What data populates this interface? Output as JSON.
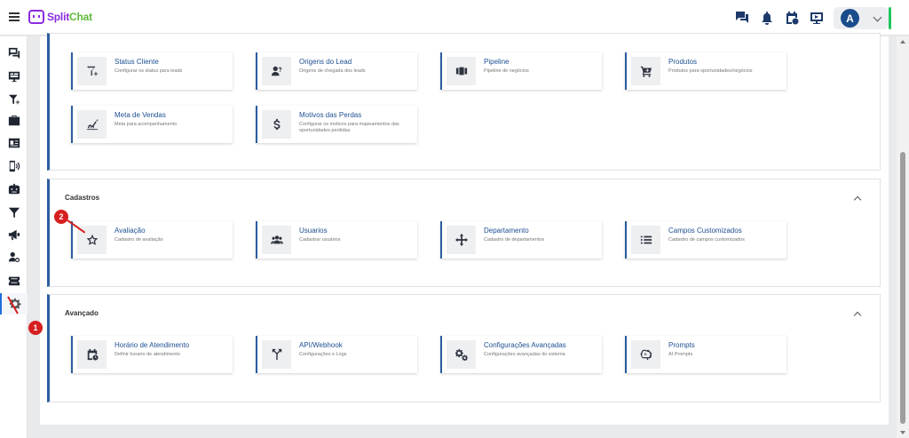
{
  "app": {
    "logo_split": "Split",
    "logo_chat": "Chat"
  },
  "user": {
    "initial": "A"
  },
  "colors": {
    "accent": "#2b5d9f",
    "marker": "#d61f1f",
    "brand_purple": "#8a2be2",
    "brand_green": "#5fb83a"
  },
  "top_icons": [
    "chat-icon",
    "bell-icon",
    "calendar-clock-icon",
    "video-icon"
  ],
  "rail_icons": [
    "conversations-icon",
    "monitor-icon",
    "filter-plus-icon",
    "briefcase-icon",
    "contact-card-icon",
    "phone-signal-icon",
    "robot-icon",
    "filter-icon",
    "megaphone-icon",
    "user-search-icon",
    "ticket-icon",
    "gear-icon"
  ],
  "sections": {
    "top": {
      "cards": [
        {
          "title": "Status Cliente",
          "desc": "Configurar os status para leads",
          "icon": "filter-plus-icon"
        },
        {
          "title": "Origens do Lead",
          "desc": "Origens de chegada dos leads",
          "icon": "user-question-icon"
        },
        {
          "title": "Pipeline",
          "desc": "Pipeline de negócios",
          "icon": "pipeline-icon"
        },
        {
          "title": "Produtos",
          "desc": "Produtos para oportunidades/negócios",
          "icon": "cart-plus-icon"
        },
        {
          "title": "Meta de Vendas",
          "desc": "Meta para acompanhamento",
          "icon": "chart-trend-icon"
        },
        {
          "title": "Motivos das Perdas",
          "desc": "Configurar os motivos para mapeamentos das oportunidades perdidas",
          "icon": "dollar-icon"
        }
      ]
    },
    "cadastros": {
      "title": "Cadastros",
      "cards": [
        {
          "title": "Avaliação",
          "desc": "Cadastro de avaliação",
          "icon": "star-icon"
        },
        {
          "title": "Usuarios",
          "desc": "Cadastrar usuários",
          "icon": "users-icon"
        },
        {
          "title": "Departamento",
          "desc": "Cadastro de departamentos",
          "icon": "move-arrows-icon"
        },
        {
          "title": "Campos Customizados",
          "desc": "Cadastro de campos customizados",
          "icon": "list-icon"
        }
      ]
    },
    "avancado": {
      "title": "Avançado",
      "cards": [
        {
          "title": "Horário de Atendimento",
          "desc": "Definir horario de atendimento",
          "icon": "calendar-clock-icon"
        },
        {
          "title": "API/Webhook",
          "desc": "Configurações e Logs",
          "icon": "merge-arrows-icon"
        },
        {
          "title": "Configurações Avançadas",
          "desc": "Configurações avançadas do sistema",
          "icon": "gears-icon"
        },
        {
          "title": "Prompts",
          "desc": "AI Prompts",
          "icon": "brain-icon"
        }
      ]
    }
  },
  "markers": {
    "one": "1",
    "two": "2"
  }
}
